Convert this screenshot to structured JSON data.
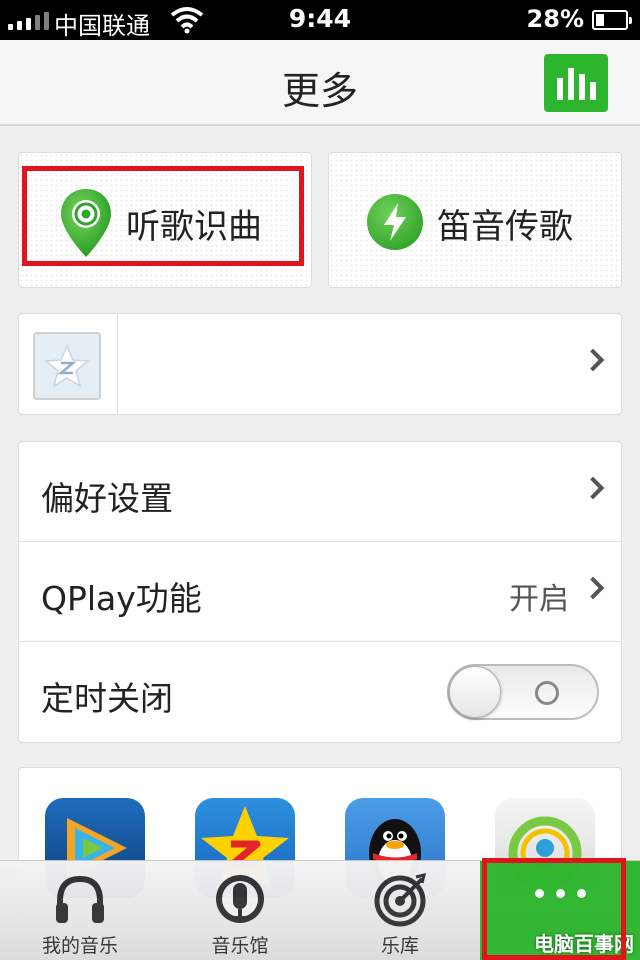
{
  "status_bar": {
    "carrier": "中国联通",
    "time": "9:44",
    "battery": "28%"
  },
  "nav": {
    "title": "更多",
    "right_icon": "equalizer-icon"
  },
  "tiles": [
    {
      "label": "听歌识曲",
      "icon": "location-pin-icon"
    },
    {
      "label": "笛音传歌",
      "icon": "lightning-icon"
    }
  ],
  "profile": {
    "avatar_icon": "qq-music-star-icon"
  },
  "settings": [
    {
      "label": "偏好设置"
    },
    {
      "label": "QPlay功能",
      "value": "开启"
    },
    {
      "label": "定时关闭",
      "toggle": "off"
    }
  ],
  "apps": [
    {
      "icon": "tencent-video-icon"
    },
    {
      "icon": "qq-music-icon"
    },
    {
      "icon": "qq-penguin-icon"
    },
    {
      "icon": "green-app-icon"
    }
  ],
  "tabs": [
    {
      "label": "我的音乐",
      "icon": "headphones-icon"
    },
    {
      "label": "音乐馆",
      "icon": "microphone-icon"
    },
    {
      "label": "乐库",
      "icon": "target-icon"
    },
    {
      "label": "",
      "icon": "more-icon"
    }
  ],
  "watermark": "电脑百事网",
  "colors": {
    "accent_green": "#2db52e",
    "highlight_red": "#e0141b"
  }
}
